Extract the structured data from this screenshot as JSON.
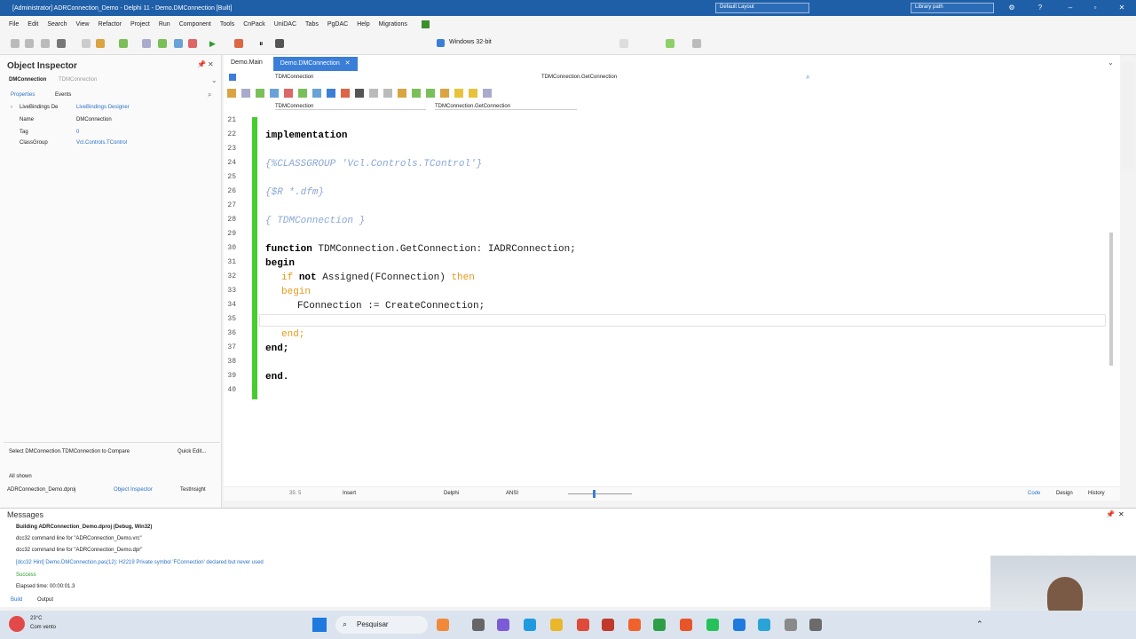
{
  "window": {
    "title": "[Administrator] ADRConnection_Demo - Delphi 11 - Demo.DMConnection [Built]",
    "layout_select": "Default Layout",
    "library_path": "Library path"
  },
  "menu": [
    "File",
    "Edit",
    "Search",
    "View",
    "Refactor",
    "Project",
    "Run",
    "Component",
    "Tools",
    "CnPack",
    "UniDAC",
    "Tabs",
    "PgDAC",
    "Help",
    "Migrations"
  ],
  "toolbar": {
    "platform": "Windows 32-bit"
  },
  "inspector": {
    "title": "Object Inspector",
    "component": "DMConnection",
    "component_type": "TDMConnection",
    "tab_properties": "Properties",
    "tab_events": "Events",
    "properties": [
      {
        "name": "LiveBindings De",
        "value": "LiveBindings Designer"
      },
      {
        "name": "Name",
        "value": "DMConnection"
      },
      {
        "name": "Tag",
        "value": "0"
      },
      {
        "name": "ClassGroup",
        "value": "Vcl.Controls.TControl"
      }
    ],
    "compare_text": "Select DMConnection.TDMConnection to Compare",
    "quick_edit": "Quick Edit...",
    "all_shown": "All shown",
    "bottom_tabs": [
      "ADRConnection_Demo.dproj",
      "Object Inspector",
      "TestInsight"
    ]
  },
  "editor": {
    "tabs": [
      "Demo.Main",
      "Demo.DMConnection"
    ],
    "breadcrumb_left": "TDMConnection",
    "breadcrumb_right": "TDMConnection.GetConnection",
    "class_select": "TDMConnection",
    "method_select": "TDMConnection.GetConnection",
    "line_numbers": [
      "21",
      "22",
      "23",
      "24",
      "25",
      "26",
      "27",
      "28",
      "29",
      "30",
      "31",
      "32",
      "33",
      "34",
      "35",
      "36",
      "37",
      "38",
      "39",
      "40"
    ],
    "code": {
      "l22": "implementation",
      "l24": "{%CLASSGROUP 'Vcl.Controls.TControl'}",
      "l26": "{$R *.dfm}",
      "l28": "{ TDMConnection }",
      "l30_kw": "function",
      "l30_rest": " TDMConnection.GetConnection: IADRConnection;",
      "l31": "begin",
      "l32_kw1": "if",
      "l32_kw2": "not",
      "l32_rest": " Assigned(FConnection) ",
      "l32_then": "then",
      "l33": "begin",
      "l34": "FConnection := CreateConnection;",
      "l36": "end;",
      "l37": "end;",
      "l39": "end."
    },
    "status": {
      "position": "35: 5",
      "mode": "Insert",
      "language": "Delphi",
      "encoding": "ANSI",
      "view_code": "Code",
      "view_design": "Design",
      "view_history": "History"
    }
  },
  "messages": {
    "title": "Messages",
    "lines": [
      "Building ADRConnection_Demo.dproj (Debug, Win32)",
      "dcc32 command line for \"ADRConnection_Demo.vrc\"",
      "dcc32 command line for \"ADRConnection_Demo.dpr\"",
      "[dcc32 Hint] Demo.DMConnection.pas(12): H2219 Private symbol 'FConnection' declared but never used",
      "Success",
      "Elapsed time: 00:00:01.3"
    ],
    "tabs": [
      "Build",
      "Output"
    ]
  },
  "taskbar": {
    "weather": "23°C",
    "weather_desc": "Com vento",
    "search_placeholder": "Pesquisar"
  }
}
